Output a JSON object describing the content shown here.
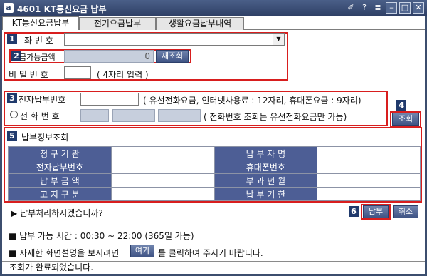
{
  "window": {
    "title": "4601 KT통신요금 납부",
    "icon_label": "a"
  },
  "titlebar_controls": [
    "pin",
    "?",
    "menu",
    "minimize",
    "maximize",
    "close"
  ],
  "tabs": [
    {
      "label": "KT통신요금납부",
      "active": true
    },
    {
      "label": "전기요금납부",
      "active": false
    },
    {
      "label": "생활요금납부내역",
      "active": false
    }
  ],
  "section1": {
    "number": "1",
    "account_label": "좌 번 호",
    "account_value": "",
    "number2": "2",
    "available_label": "급가능금액",
    "available_value": "0",
    "recheck_button": "재조회",
    "password_label": "비 밀 번 호",
    "password_hint": "( 4자리 입력 )"
  },
  "section3": {
    "number": "3",
    "epay_label": "전자납부번호",
    "epay_hint": "( 유선전화요금, 인터넷사용료 : 12자리, 휴대폰요금 : 9자리)",
    "phone_label": "전 화 번 호",
    "phone_hint": "( 전화번호 조회는 유선전화요금만 가능)"
  },
  "section4": {
    "number": "4",
    "query_button": "조회"
  },
  "section5": {
    "number": "5",
    "title": "납부정보조회",
    "rows": [
      {
        "left_label": "청 구 기 관",
        "left_value": "",
        "right_label": "납 부 자 명",
        "right_value": ""
      },
      {
        "left_label": "전자납부번호",
        "left_value": "",
        "right_label": "휴대폰번호",
        "right_value": ""
      },
      {
        "left_label": "납 부 금 액",
        "left_value": "",
        "right_label": "부 과 년 월",
        "right_value": ""
      },
      {
        "left_label": "고 지 구 분",
        "left_value": "",
        "right_label": "납 부 기 한",
        "right_value": ""
      }
    ]
  },
  "confirm_prompt": "▶ 납부처리하시겠습니까?",
  "section6": {
    "number": "6",
    "pay_button": "납부",
    "cancel_button": "취소"
  },
  "notes": {
    "hours": "■ 납부 가능 시간 : 00:30 ~ 22:00 (365일 가능)",
    "help_prefix": "■ 자세한 화면설명을 보시려면",
    "help_link": "여기",
    "help_suffix": "를 클릭하여 주시기 바랍니다."
  },
  "status": "조회가 완료되었습니다.",
  "colors": {
    "accent": "#d81e1e",
    "header": "#4d5e95",
    "badge": "#203a6c",
    "titlebar": "#3c4e6e"
  }
}
